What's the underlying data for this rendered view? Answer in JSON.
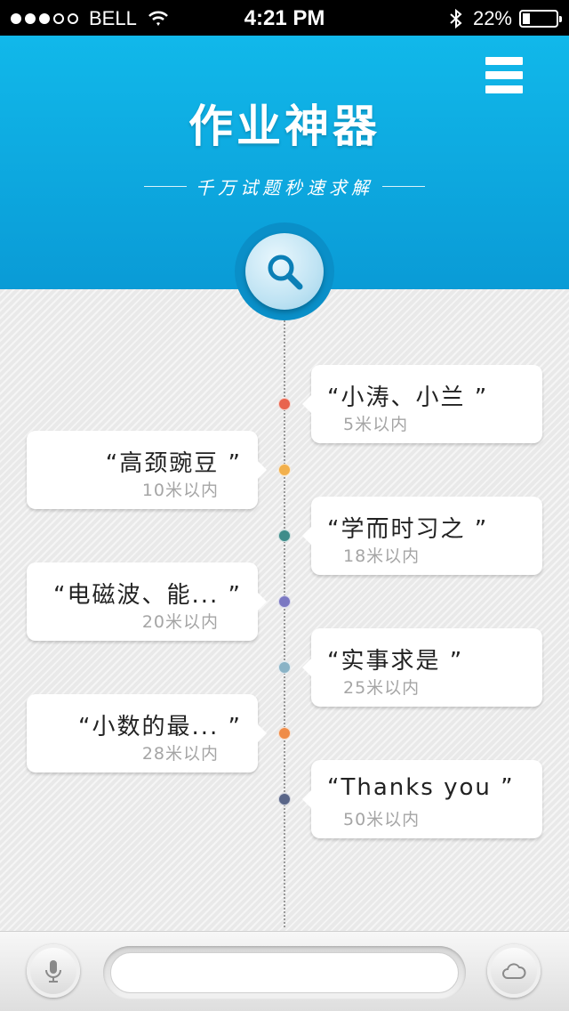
{
  "status_bar": {
    "signal_dots": [
      true,
      true,
      true,
      false,
      false
    ],
    "carrier": "BELL",
    "time": "4:21 PM",
    "battery_text": "22%",
    "battery_level": 0.22,
    "icons": [
      "wifi-icon",
      "bluetooth-icon",
      "battery-icon"
    ]
  },
  "header": {
    "title": "作业神器",
    "subtitle": "千万试题秒速求解",
    "menu_icon": "hamburger-menu-icon",
    "search_icon": "magnifier-icon",
    "colors": {
      "top": "#11b8ea",
      "bottom": "#0a9bd6"
    }
  },
  "timeline": {
    "items": [
      {
        "side": "right",
        "text": "“小涛、小兰 ”",
        "distance": "5米以内",
        "dot_color": "#e8644e"
      },
      {
        "side": "left",
        "text": "“高颈豌豆 ”",
        "distance": "10米以内",
        "dot_color": "#f2b04c"
      },
      {
        "side": "right",
        "text": "“学而时习之 ”",
        "distance": "18米以内",
        "dot_color": "#3e8c8a"
      },
      {
        "side": "left",
        "text": "“电磁波、能... ”",
        "distance": "20米以内",
        "dot_color": "#7b78c2"
      },
      {
        "side": "right",
        "text": "“实事求是 ”",
        "distance": "25米以内",
        "dot_color": "#8ab3c6"
      },
      {
        "side": "left",
        "text": "“小数的最... ”",
        "distance": "28米以内",
        "dot_color": "#ef8c48"
      },
      {
        "side": "right",
        "text": "“Thanks you ”",
        "distance": "50米以内",
        "dot_color": "#5a6688"
      }
    ]
  },
  "bottom_bar": {
    "mic_icon": "microphone-icon",
    "cloud_icon": "cloud-icon",
    "input_value": "",
    "input_placeholder": ""
  }
}
